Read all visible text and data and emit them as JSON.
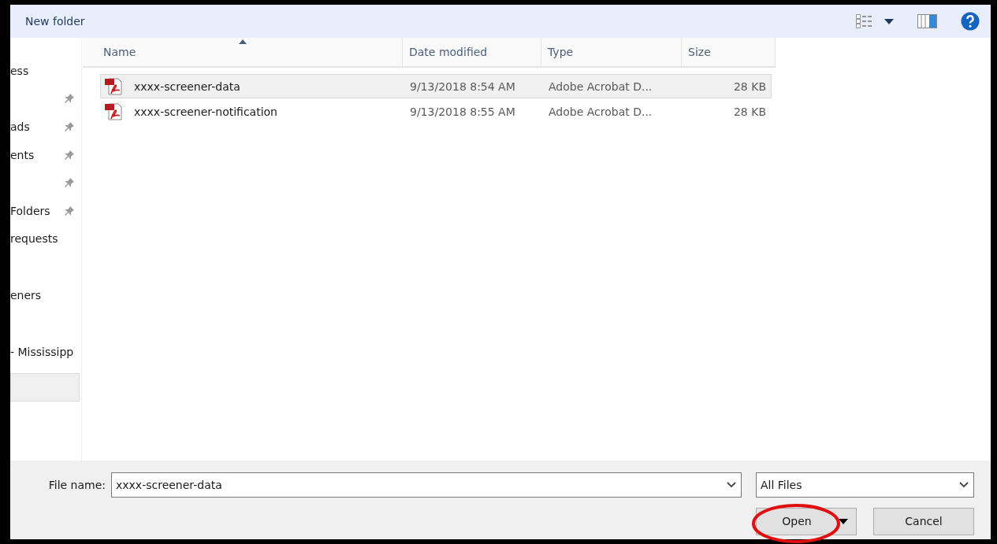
{
  "toolbar": {
    "new_folder": "New folder"
  },
  "sidebar": {
    "groups": [
      {
        "items": [
          {
            "label": "ess",
            "pinned": false
          },
          {
            "pinned": true
          },
          {
            "label": "ads",
            "pinned": true
          },
          {
            "label": "ents",
            "pinned": true
          },
          {
            "pinned": true
          },
          {
            "label": "Folders",
            "pinned": true
          },
          {
            "label": "requests",
            "pinned": false
          }
        ]
      },
      {
        "items": [
          {
            "label": "eners",
            "pinned": false
          }
        ]
      },
      {
        "items": [
          {
            "label": "- Mississipp",
            "pinned": false
          }
        ]
      }
    ]
  },
  "table": {
    "columns": [
      {
        "label": "Name",
        "sorted": true
      },
      {
        "label": "Date modified",
        "sorted": false
      },
      {
        "label": "Type",
        "sorted": false
      },
      {
        "label": "Size",
        "sorted": false
      }
    ],
    "rows": [
      {
        "name": "xxxx-screener-data",
        "date": "9/13/2018 8:54 AM",
        "type": "Adobe Acrobat D...",
        "size": "28 KB",
        "selected": true
      },
      {
        "name": "xxxx-screener-notification",
        "date": "9/13/2018 8:55 AM",
        "type": "Adobe Acrobat D...",
        "size": "28 KB",
        "selected": false
      }
    ]
  },
  "footer": {
    "file_name_label": "File name:",
    "file_name_value": "xxxx-screener-data",
    "filter": "All Files",
    "open_button": "Open",
    "cancel_button": "Cancel",
    "open_highlighted": true
  }
}
